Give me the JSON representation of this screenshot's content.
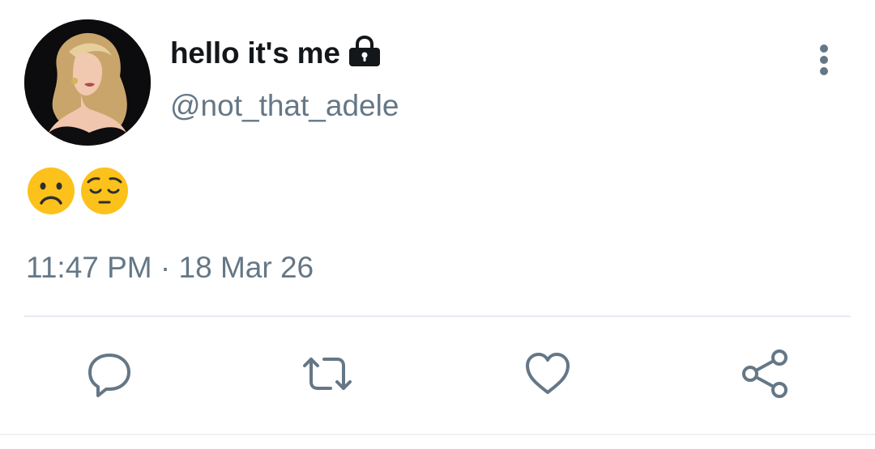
{
  "tweet": {
    "display_name": "hello it's me",
    "handle": "@not_that_adele",
    "text_emojis": [
      "frowning-face",
      "pensive-face"
    ],
    "timestamp": "11:47 PM · 18 Mar 26",
    "account_protected": true
  },
  "icons": {
    "lock": "lock-icon",
    "more": "vertical-ellipsis-icon",
    "reply": "speech-bubble-icon",
    "retweet": "retweet-icon",
    "like": "heart-icon",
    "share": "share-icon"
  },
  "colors": {
    "name_text": "#14171a",
    "secondary_text": "#657786",
    "divider": "#e6ecf0",
    "emoji_yellow": "#fcc21b"
  }
}
